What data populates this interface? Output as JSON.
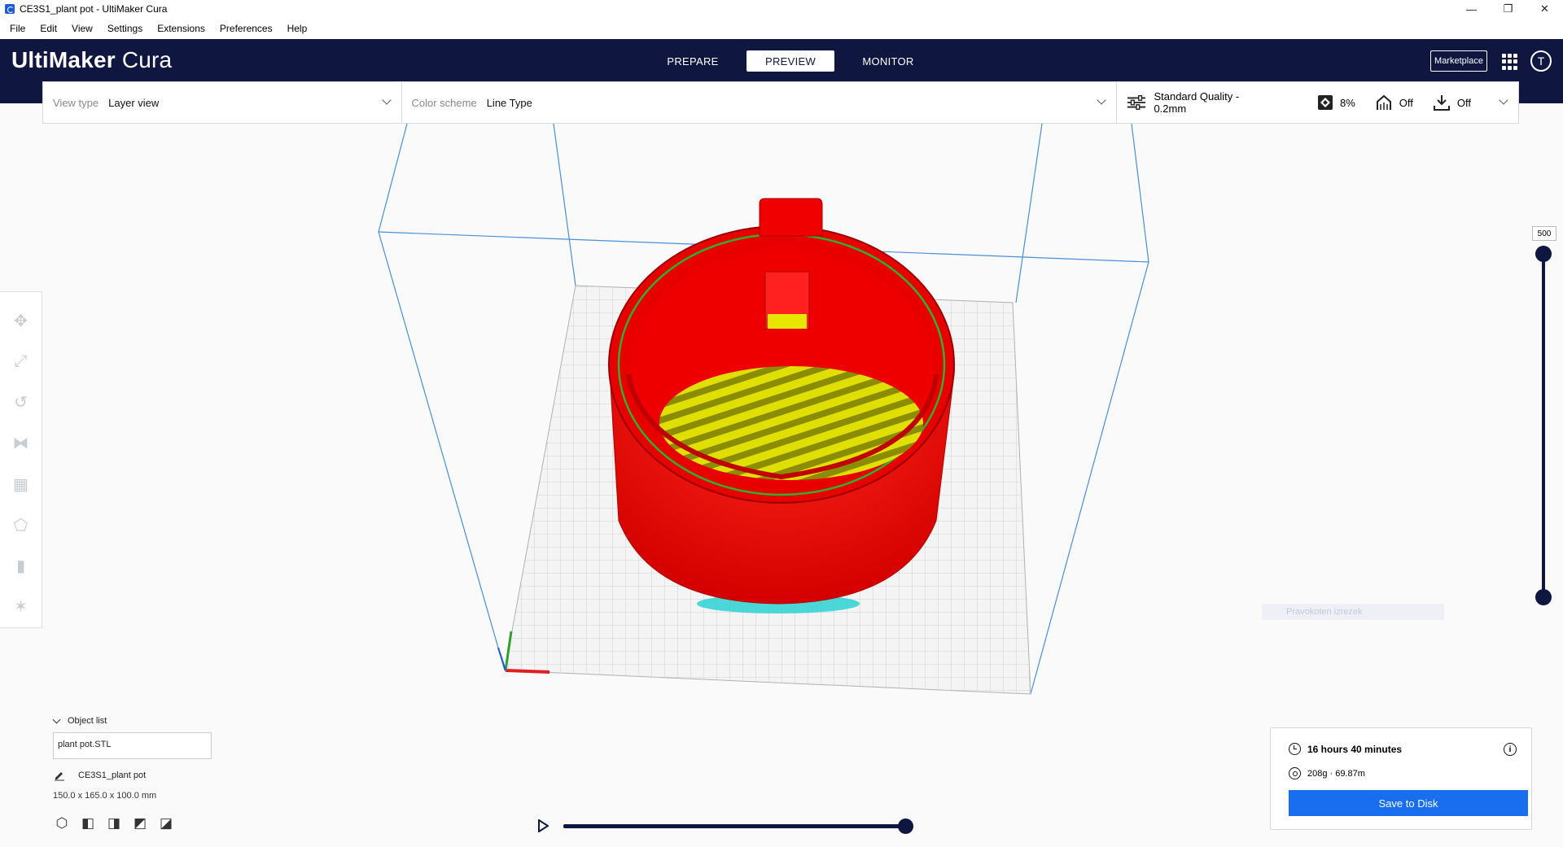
{
  "window": {
    "title": "CE3S1_plant pot - UltiMaker Cura",
    "controls": [
      "—",
      "❐",
      "✕"
    ]
  },
  "menu": [
    {
      "label": "File"
    },
    {
      "label": "Edit"
    },
    {
      "label": "View"
    },
    {
      "label": "Settings"
    },
    {
      "label": "Extensions"
    },
    {
      "label": "Preferences"
    },
    {
      "label": "Help"
    }
  ],
  "header": {
    "brand_bold": "UltiMaker",
    "brand_light": "Cura",
    "tabs": [
      {
        "label": "PREPARE",
        "active": false
      },
      {
        "label": "PREVIEW",
        "active": true
      },
      {
        "label": "MONITOR",
        "active": false
      }
    ],
    "marketplace_label": "Marketplace",
    "avatar_letter": "T"
  },
  "viewbar": {
    "view_type_label": "View type",
    "view_type_value": "Layer view",
    "color_scheme_label": "Color scheme",
    "color_scheme_value": "Line Type",
    "quality": "Standard Quality - 0.2mm",
    "infill": "8%",
    "support": "Off",
    "adhesion": "Off"
  },
  "tools": [
    {
      "name": "move-icon"
    },
    {
      "name": "scale-icon"
    },
    {
      "name": "rotate-icon"
    },
    {
      "name": "mirror-icon"
    },
    {
      "name": "per-model-settings-icon"
    },
    {
      "name": "support-blocker-icon"
    },
    {
      "name": "cylinder-mesh-icon"
    },
    {
      "name": "paint-icon"
    }
  ],
  "layer_slider": {
    "current_layer": "500",
    "top_fraction": 1.0,
    "bottom_fraction": 0.0
  },
  "ghost_tooltip": "Pravokoten izrezek",
  "object_list": {
    "label": "Object list",
    "file": "plant pot.STL",
    "job_name": "CE3S1_plant pot",
    "dimensions": "150.0 x 165.0 x 100.0 mm"
  },
  "playback": {
    "progress": 1.0
  },
  "print_info": {
    "time": "16 hours 40 minutes",
    "material": "208g · 69.87m",
    "save_label": "Save to Disk"
  },
  "colors": {
    "header_bg": "#0f1740",
    "accent_blue": "#196ef0",
    "wall_red": "#ff0000",
    "skin_yellow": "#ffff00",
    "build_plate": "#f0f0f0"
  }
}
